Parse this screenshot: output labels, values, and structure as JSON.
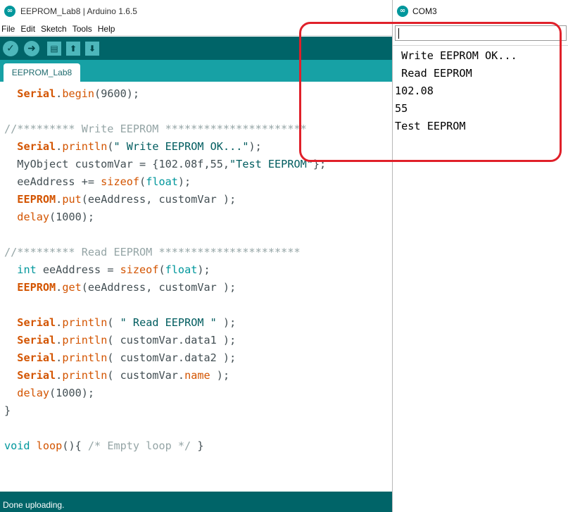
{
  "ide": {
    "window_title": "EEPROM_Lab8 | Arduino 1.6.5",
    "menu": [
      "File",
      "Edit",
      "Sketch",
      "Tools",
      "Help"
    ],
    "toolbar": {
      "verify_symbol": "✓",
      "upload_symbol": "➜",
      "new_symbol": "▤",
      "open_symbol": "⬆",
      "save_symbol": "⬇"
    },
    "tab_label": "EEPROM_Lab8",
    "code_lines": [
      [
        {
          "t": "  "
        },
        {
          "t": "Serial",
          "c": "kw-class"
        },
        {
          "t": "."
        },
        {
          "t": "begin",
          "c": "kw-fn"
        },
        {
          "t": "(9600);"
        }
      ],
      [],
      [
        {
          "t": "//********* Write EEPROM **********************",
          "c": "cmt"
        }
      ],
      [
        {
          "t": "  "
        },
        {
          "t": "Serial",
          "c": "kw-class"
        },
        {
          "t": "."
        },
        {
          "t": "println",
          "c": "kw-fn"
        },
        {
          "t": "("
        },
        {
          "t": "\" Write EEPROM OK...\"",
          "c": "str"
        },
        {
          "t": ");"
        }
      ],
      [
        {
          "t": "  MyObject customVar = {102.08f,55,"
        },
        {
          "t": "\"Test EEPROM\"",
          "c": "str"
        },
        {
          "t": "};"
        }
      ],
      [
        {
          "t": "  eeAddress += "
        },
        {
          "t": "sizeof",
          "c": "kw-fn"
        },
        {
          "t": "("
        },
        {
          "t": "float",
          "c": "kw-type"
        },
        {
          "t": ");"
        }
      ],
      [
        {
          "t": "  "
        },
        {
          "t": "EEPROM",
          "c": "kw-class"
        },
        {
          "t": "."
        },
        {
          "t": "put",
          "c": "kw-fn"
        },
        {
          "t": "(eeAddress, customVar );"
        }
      ],
      [
        {
          "t": "  "
        },
        {
          "t": "delay",
          "c": "kw-fn"
        },
        {
          "t": "(1000);"
        }
      ],
      [],
      [
        {
          "t": "//********* Read EEPROM **********************",
          "c": "cmt"
        }
      ],
      [
        {
          "t": "  "
        },
        {
          "t": "int",
          "c": "kw-type"
        },
        {
          "t": " eeAddress = "
        },
        {
          "t": "sizeof",
          "c": "kw-fn"
        },
        {
          "t": "("
        },
        {
          "t": "float",
          "c": "kw-type"
        },
        {
          "t": ");"
        }
      ],
      [
        {
          "t": "  "
        },
        {
          "t": "EEPROM",
          "c": "kw-class"
        },
        {
          "t": "."
        },
        {
          "t": "get",
          "c": "kw-fn"
        },
        {
          "t": "(eeAddress, customVar );"
        }
      ],
      [],
      [
        {
          "t": "  "
        },
        {
          "t": "Serial",
          "c": "kw-class"
        },
        {
          "t": "."
        },
        {
          "t": "println",
          "c": "kw-fn"
        },
        {
          "t": "( "
        },
        {
          "t": "\" Read EEPROM \"",
          "c": "str"
        },
        {
          "t": " );"
        }
      ],
      [
        {
          "t": "  "
        },
        {
          "t": "Serial",
          "c": "kw-class"
        },
        {
          "t": "."
        },
        {
          "t": "println",
          "c": "kw-fn"
        },
        {
          "t": "( customVar.data1 );"
        }
      ],
      [
        {
          "t": "  "
        },
        {
          "t": "Serial",
          "c": "kw-class"
        },
        {
          "t": "."
        },
        {
          "t": "println",
          "c": "kw-fn"
        },
        {
          "t": "( customVar.data2 );"
        }
      ],
      [
        {
          "t": "  "
        },
        {
          "t": "Serial",
          "c": "kw-class"
        },
        {
          "t": "."
        },
        {
          "t": "println",
          "c": "kw-fn"
        },
        {
          "t": "( customVar."
        },
        {
          "t": "name",
          "c": "kw-fn"
        },
        {
          "t": " );"
        }
      ],
      [
        {
          "t": "  "
        },
        {
          "t": "delay",
          "c": "kw-fn"
        },
        {
          "t": "(1000);"
        }
      ],
      [
        {
          "t": "}"
        }
      ],
      [],
      [
        {
          "t": "void",
          "c": "kw-type"
        },
        {
          "t": " "
        },
        {
          "t": "loop",
          "c": "kw-fn"
        },
        {
          "t": "(){ "
        },
        {
          "t": "/* Empty loop */",
          "c": "cmt"
        },
        {
          "t": " }"
        }
      ]
    ],
    "status": "Done uploading."
  },
  "serial_monitor": {
    "window_title": "COM3",
    "input_value": "",
    "output_lines": [
      " Write EEPROM OK...",
      " Read EEPROM",
      "102.08",
      "55",
      "Test EEPROM"
    ]
  },
  "colors": {
    "toolbar_bg": "#006468",
    "tabstrip_bg": "#17a1a5",
    "highlight": "#e0202a"
  }
}
